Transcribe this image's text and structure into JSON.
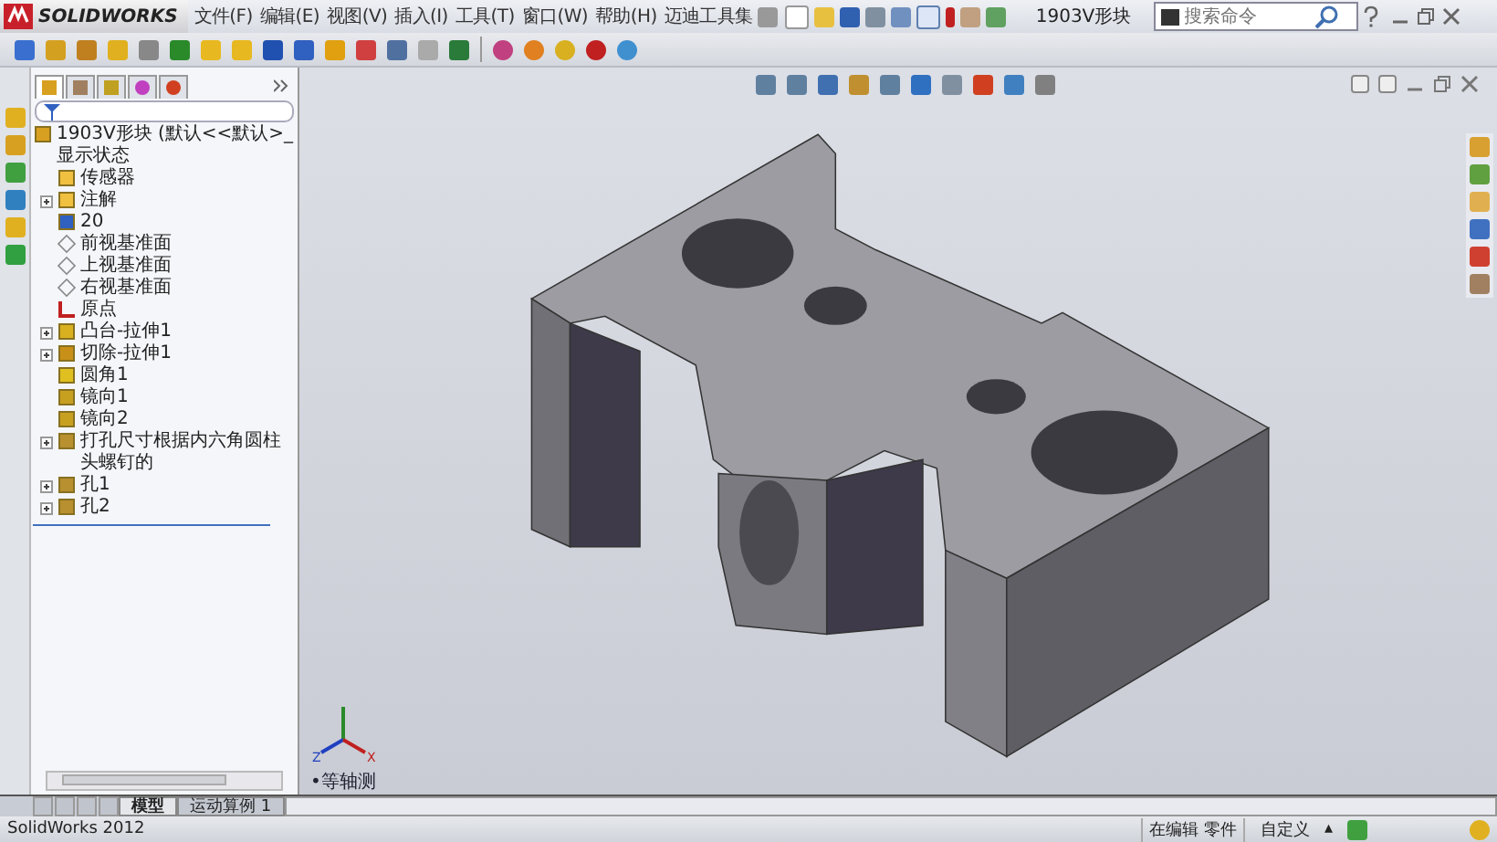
{
  "app": {
    "logo": "SOLIDWORKS",
    "menus": [
      "文件(F)",
      "编辑(E)",
      "视图(V)",
      "插入(I)",
      "工具(T)",
      "窗口(W)",
      "帮助(H)",
      "迈迪工具集"
    ],
    "document_title": "1903V形块",
    "search": {
      "placeholder": "搜索命令"
    }
  },
  "feature_tree": {
    "root": "1903V形块  (默认<<默认>_显示状态",
    "items": [
      {
        "label": "传感器",
        "kind": "sensor",
        "collapsed": false
      },
      {
        "label": "注解",
        "kind": "annotation",
        "collapsed": true
      },
      {
        "label": "20",
        "kind": "dimension",
        "collapsed": false
      },
      {
        "label": "前视基准面",
        "kind": "plane",
        "collapsed": false
      },
      {
        "label": "上视基准面",
        "kind": "plane",
        "collapsed": false
      },
      {
        "label": "右视基准面",
        "kind": "plane",
        "collapsed": false
      },
      {
        "label": "原点",
        "kind": "origin",
        "collapsed": false
      },
      {
        "label": "凸台-拉伸1",
        "kind": "boss",
        "collapsed": true
      },
      {
        "label": "切除-拉伸1",
        "kind": "cut",
        "collapsed": true
      },
      {
        "label": "圆角1",
        "kind": "fillet",
        "collapsed": false
      },
      {
        "label": "镜向1",
        "kind": "mirror",
        "collapsed": false
      },
      {
        "label": "镜向2",
        "kind": "mirror",
        "collapsed": false
      },
      {
        "label": "打孔尺寸根据内六角圆柱头螺钉的",
        "kind": "hole",
        "collapsed": true
      },
      {
        "label": "孔1",
        "kind": "hole",
        "collapsed": true
      },
      {
        "label": "孔2",
        "kind": "hole",
        "collapsed": true
      }
    ]
  },
  "viewport": {
    "view_label": "•等轴测",
    "triad": [
      "Z",
      "X"
    ]
  },
  "bottom_tabs": [
    {
      "label": "模型",
      "selected": true
    },
    {
      "label": "运动算例 1",
      "selected": false
    }
  ],
  "status_bar": {
    "app": "SolidWorks 2012",
    "mode": "在编辑 零件",
    "units": "自定义",
    "units_caret": "▴"
  }
}
